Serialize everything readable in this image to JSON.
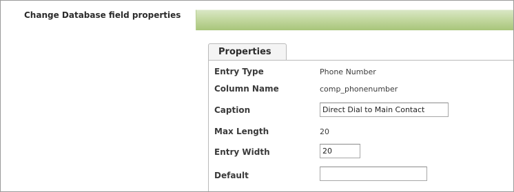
{
  "header": {
    "title": "Change Database field properties"
  },
  "tabs": [
    {
      "label": "Properties"
    }
  ],
  "properties": {
    "entry_type": {
      "label": "Entry Type",
      "value": "Phone Number"
    },
    "column_name": {
      "label": "Column Name",
      "value": "comp_phonenumber"
    },
    "caption": {
      "label": "Caption",
      "value": "Direct Dial to Main Contact"
    },
    "max_length": {
      "label": "Max Length",
      "value": "20"
    },
    "entry_width": {
      "label": "Entry Width",
      "value": "20"
    },
    "default": {
      "label": "Default",
      "value": ""
    }
  },
  "colors": {
    "header_bar_top": "#d9e7c4",
    "header_bar_bottom": "#a8c57a",
    "border": "#b9b9b9"
  }
}
